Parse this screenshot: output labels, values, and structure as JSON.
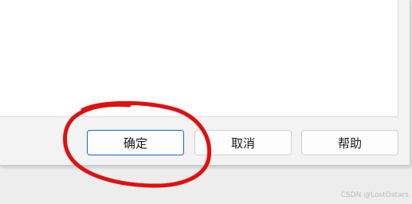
{
  "dialog": {
    "buttons": {
      "ok_label": "确定",
      "cancel_label": "取消",
      "help_label": "帮助"
    }
  },
  "annotation": {
    "type": "hand-drawn-circle",
    "color": "#e01010",
    "target": "ok-button"
  },
  "watermark": {
    "text": "CSDN @LostOstars"
  },
  "colors": {
    "focus_border": "#1a64c8",
    "dialog_background": "#f3f3f3",
    "page_background": "#ededed"
  }
}
